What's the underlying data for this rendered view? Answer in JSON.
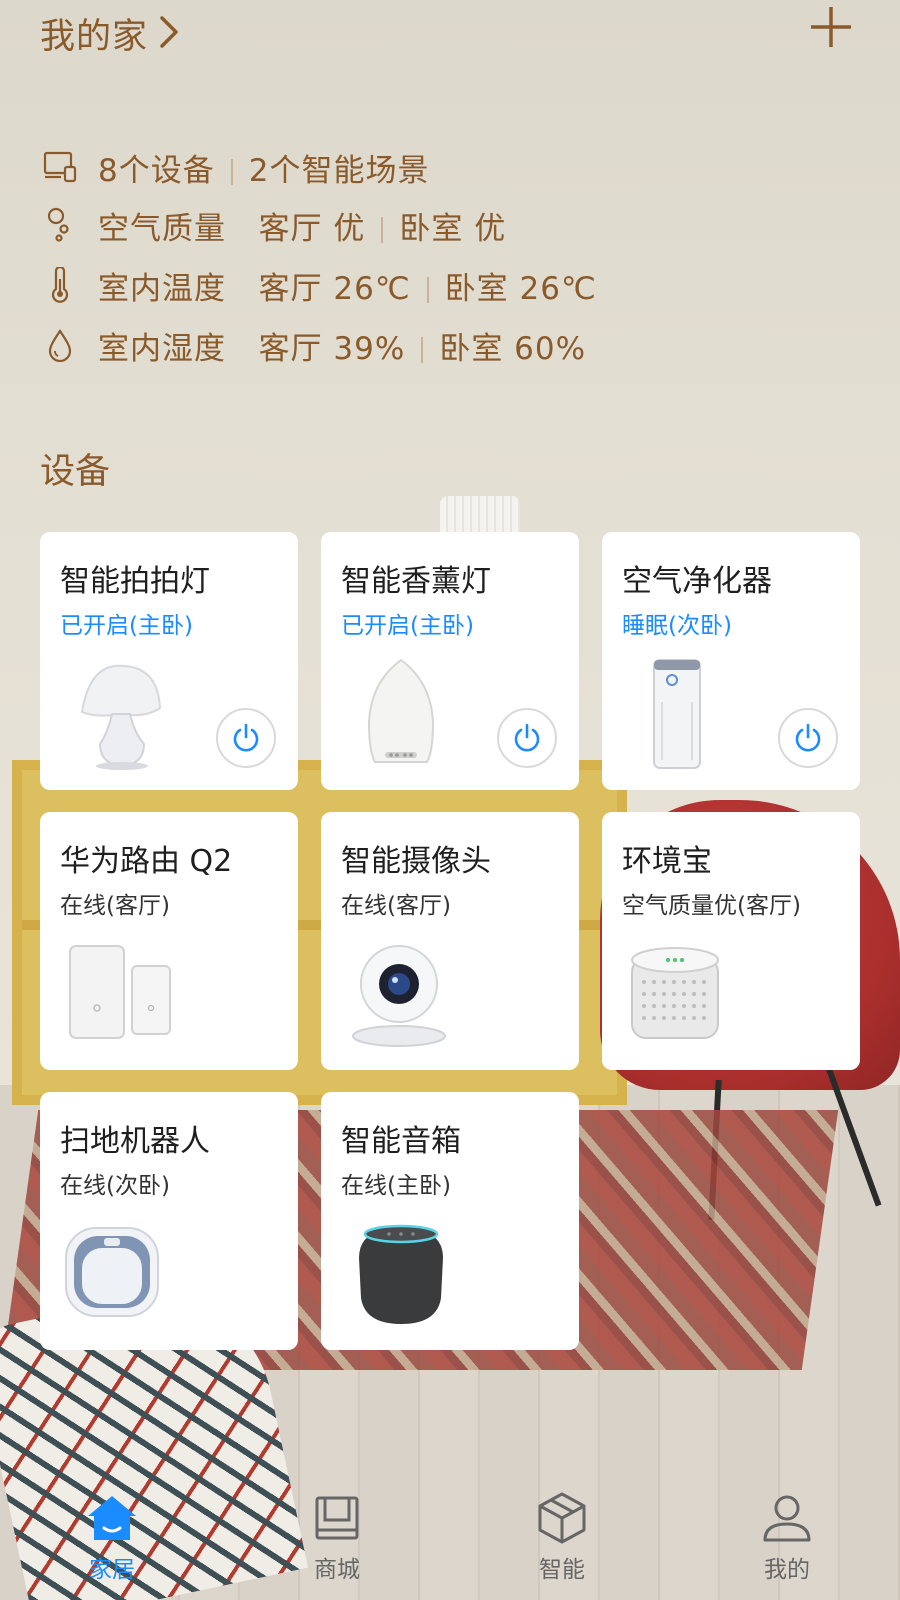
{
  "header": {
    "title": "我的家",
    "add_label": "+"
  },
  "summary": {
    "devices": "8个设备",
    "scenes": "2个智能场景",
    "air_label": "空气质量",
    "air_living": "客厅 优",
    "air_bedroom": "卧室 优",
    "temp_label": "室内温度",
    "temp_living": "客厅 26℃",
    "temp_bedroom": "卧室 26℃",
    "hum_label": "室内湿度",
    "hum_living": "客厅 39%",
    "hum_bedroom": "卧室 60%"
  },
  "section_title": "设备",
  "devices": [
    {
      "name": "智能拍拍灯",
      "status": "已开启(主卧)",
      "icon": "lamp-icon",
      "has_power": true,
      "status_active": true
    },
    {
      "name": "智能香薰灯",
      "status": "已开启(主卧)",
      "icon": "aroma-diffuser-icon",
      "has_power": true,
      "status_active": true
    },
    {
      "name": "空气净化器",
      "status": "睡眠(次卧)",
      "icon": "air-purifier-icon",
      "has_power": true,
      "status_active": true
    },
    {
      "name": "华为路由 Q2",
      "status": "在线(客厅)",
      "icon": "router-icon",
      "has_power": false,
      "status_active": false
    },
    {
      "name": "智能摄像头",
      "status": "在线(客厅)",
      "icon": "camera-icon",
      "has_power": false,
      "status_active": false
    },
    {
      "name": "环境宝",
      "status": "空气质量优(客厅)",
      "icon": "env-monitor-icon",
      "has_power": false,
      "status_active": false
    },
    {
      "name": "扫地机器人",
      "status": "在线(次卧)",
      "icon": "robot-vacuum-icon",
      "has_power": false,
      "status_active": false
    },
    {
      "name": "智能音箱",
      "status": "在线(主卧)",
      "icon": "smart-speaker-icon",
      "has_power": false,
      "status_active": false
    }
  ],
  "tabs": [
    {
      "label": "家居",
      "icon": "home-icon",
      "active": true
    },
    {
      "label": "商城",
      "icon": "store-icon",
      "active": false
    },
    {
      "label": "智能",
      "icon": "cube-icon",
      "active": false
    },
    {
      "label": "我的",
      "icon": "person-icon",
      "active": false
    }
  ],
  "colors": {
    "accent": "#1a8cff",
    "header_text": "#8a5a2b",
    "card_bg": "#ffffff"
  }
}
